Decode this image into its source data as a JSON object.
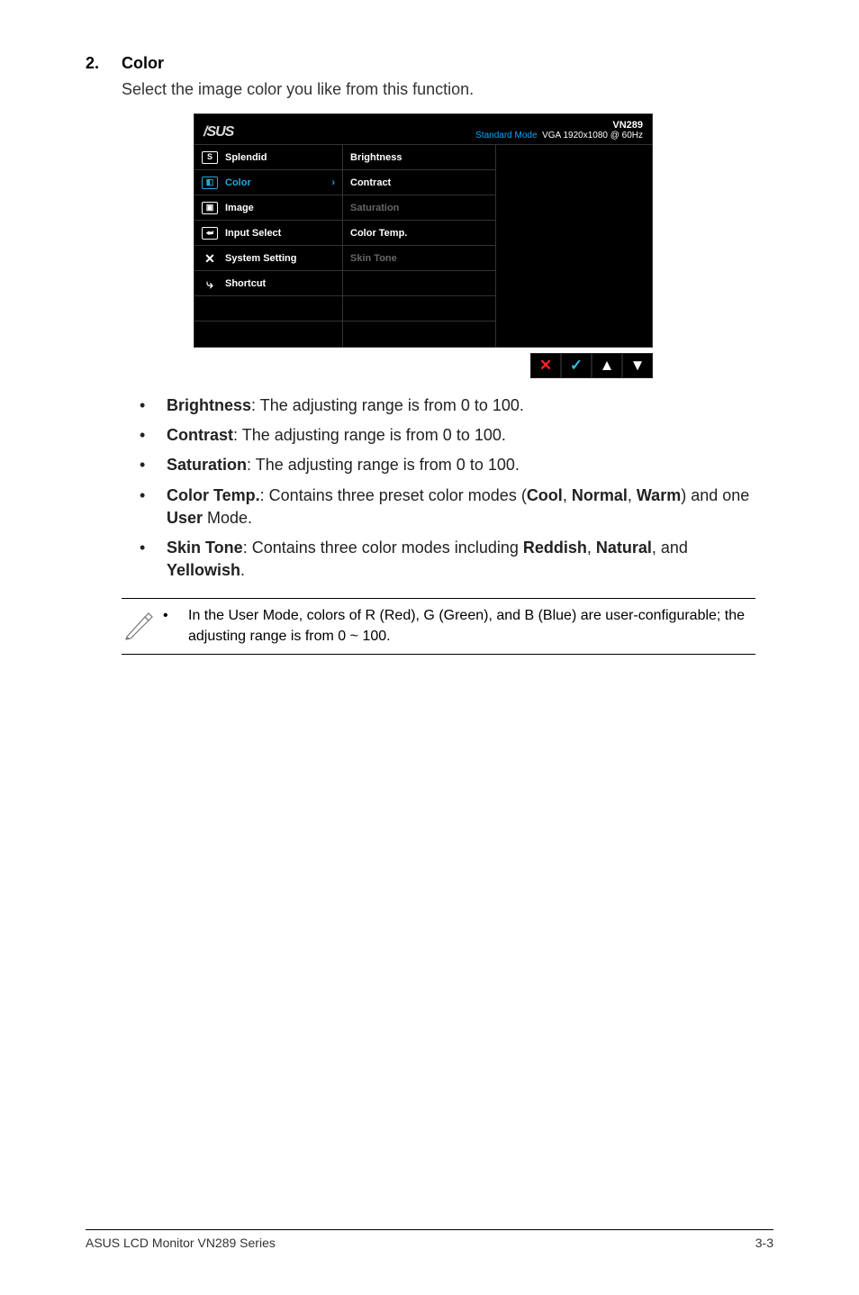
{
  "section": {
    "number": "2.",
    "title": "Color",
    "intro": "Select the image color you like from this function."
  },
  "osd": {
    "logo": "/SUS",
    "model": "VN289",
    "mode_prefix": "Standard Mode",
    "mode_suffix": "VGA 1920x1080 @ 60Hz",
    "left_items": [
      {
        "icon": "S",
        "label": "Splendid",
        "selected": false
      },
      {
        "icon": "◧",
        "label": "Color",
        "selected": true,
        "arrow": "›"
      },
      {
        "icon": "▣",
        "label": "Image",
        "selected": false
      },
      {
        "icon": "⮨",
        "label": "Input Select",
        "selected": false
      },
      {
        "icon": "✕",
        "label": "System Setting",
        "selected": false,
        "noborder": true
      },
      {
        "icon": "⤷",
        "label": "Shortcut",
        "selected": false,
        "noborder": true
      }
    ],
    "mid_items": [
      {
        "label": "Brightness",
        "dim": false
      },
      {
        "label": "Contract",
        "dim": false
      },
      {
        "label": "Saturation",
        "dim": true
      },
      {
        "label": "Color Temp.",
        "dim": false
      },
      {
        "label": "Skin Tone",
        "dim": true
      }
    ],
    "nav": {
      "close": "✕",
      "enter": "✓",
      "up": "▲",
      "down": "▼"
    }
  },
  "bullets": [
    {
      "term": "Brightness",
      "rest": ": The adjusting range is from 0 to 100."
    },
    {
      "term": "Contrast",
      "rest": ": The adjusting range is from 0 to 100."
    },
    {
      "term": "Saturation",
      "rest": ": The adjusting range is from 0 to 100."
    },
    {
      "term": "Color Temp.",
      "rest": ": Contains three preset color modes (",
      "b2": "Cool",
      "r2": ", ",
      "b3": "Normal",
      "r3": ", ",
      "b4": "Warm",
      "r4": ") and one ",
      "b5": "User",
      "r5": " Mode."
    },
    {
      "term": "Skin Tone",
      "rest": ": Contains three color modes including ",
      "b2": "Reddish",
      "r2": ", ",
      "b3": "Natural",
      "r3": ", and ",
      "b4": "Yellowish",
      "r4": "."
    }
  ],
  "note": {
    "text": "In the User Mode, colors of R (Red), G (Green), and B (Blue) are user-configurable; the adjusting range is from 0 ~ 100."
  },
  "footer": {
    "left": "ASUS LCD Monitor VN289 Series",
    "right": "3-3"
  }
}
